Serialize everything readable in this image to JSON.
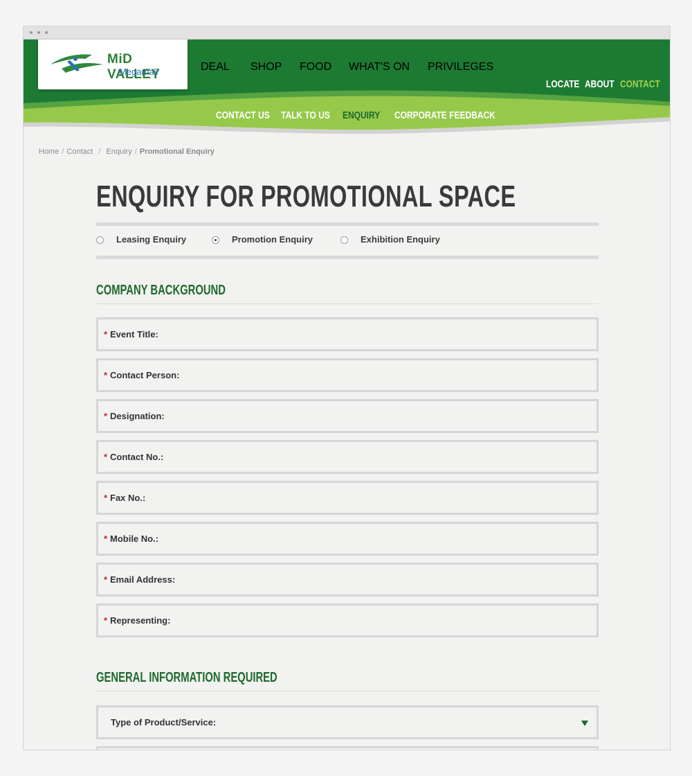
{
  "logo": {
    "name": "MiD VALLEY",
    "sub": "Megamall"
  },
  "nav": {
    "main": [
      "DEAL",
      "SHOP",
      "FOOD",
      "WHAT'S ON",
      "PRIVILEGES"
    ],
    "right": [
      "LOCATE",
      "ABOUT",
      "CONTACT"
    ],
    "sub": [
      "CONTACT US",
      "TALK TO US",
      "ENQUIRY",
      "CORPORATE FEEDBACK"
    ],
    "active_right": "CONTACT",
    "active_sub": "ENQUIRY"
  },
  "breadcrumb": {
    "items": [
      "Home",
      "Contact",
      "Enquiry"
    ],
    "current": "Promotional Enquiry",
    "separator": "/"
  },
  "page": {
    "title": "ENQUIRY FOR PROMOTIONAL SPACE"
  },
  "enquiry_types": {
    "options": [
      "Leasing Enquiry",
      "Promotion Enquiry",
      "Exhibition Enquiry"
    ],
    "selected": "Promotion Enquiry"
  },
  "company_background": {
    "title": "COMPANY BACKGROUND",
    "required_marker": "*",
    "fields": [
      "Event Title:",
      "Contact Person:",
      "Designation:",
      "Contact No.:",
      "Fax No.:",
      "Mobile No.:",
      "Email Address:",
      "Representing:"
    ]
  },
  "general_information": {
    "title": "GENERAL INFORMATION REQUIRED",
    "select_label": "Type of Product/Service:"
  },
  "colors": {
    "primary_green": "#1e7b35",
    "light_green": "#7fc241",
    "dark_green_text": "#1e6a2c",
    "required": "#c0272d"
  },
  "icons": {
    "dropdown": "caret-down-icon",
    "logo": "mid-valley-logo-icon"
  }
}
